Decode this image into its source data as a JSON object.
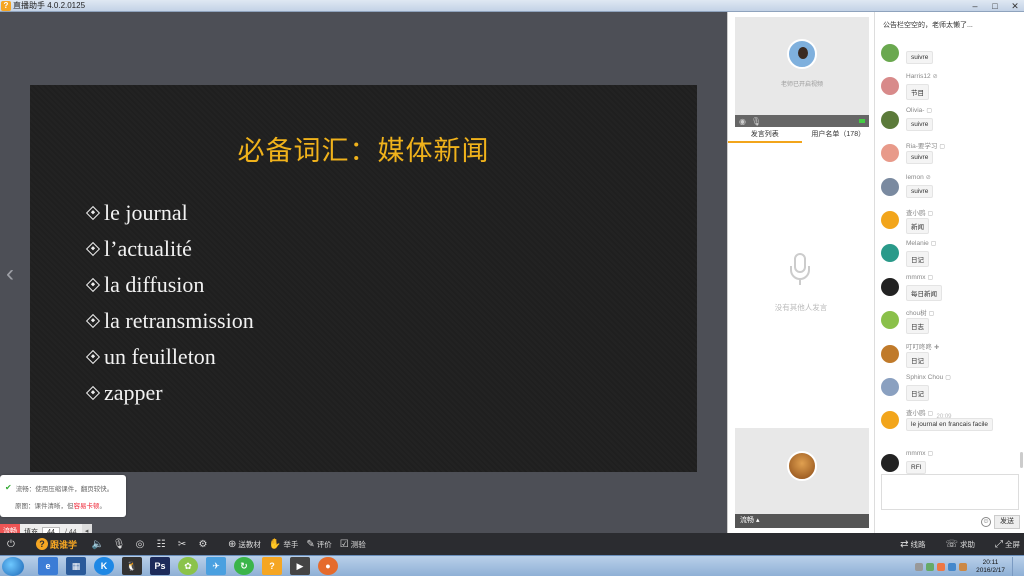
{
  "window": {
    "title": "直播助手 4.0.2.0125",
    "controls": [
      "–",
      "□",
      "✕"
    ]
  },
  "slide": {
    "title": "必备词汇：媒体新闻",
    "items": [
      "le journal",
      "l’actualité",
      "la diffusion",
      "la retransmission",
      "un feuilleton",
      "zapper"
    ]
  },
  "tip": {
    "line1": "流畅：使用压缩课件，翻页较快。",
    "line2_prefix": "原图：课件清晰，但",
    "line2_link": "容易卡顿",
    "line2_suffix": "。"
  },
  "pager": {
    "mode": "流畅",
    "fill_label": "填充",
    "current": "44",
    "total": "/ 44"
  },
  "teacher_video": {
    "caption": "老师已开启视频"
  },
  "tabs": [
    {
      "label": "发言列表"
    },
    {
      "label": "用户名单（178）"
    }
  ],
  "speak_empty": "没有其他人发言",
  "student_video": {
    "bar_label": "流畅 ▴"
  },
  "chat": {
    "notice": "公告栏空空的，老师太懒了...",
    "messages": [
      {
        "name": "",
        "badge": "",
        "text": "suivre",
        "color": "#6aa84f"
      },
      {
        "name": "Harris12",
        "badge": "⊘",
        "text": "节目",
        "color": "#d88a8a"
      },
      {
        "name": "Olivia-",
        "badge": "▢",
        "text": "suivre",
        "color": "#5b7a3a"
      },
      {
        "name": "Ria-要学习",
        "badge": "▢",
        "text": "suivre",
        "color": "#e89a8a"
      },
      {
        "name": "lemon",
        "badge": "⊘",
        "text": "suivre",
        "color": "#7a8aa0"
      },
      {
        "name": "查小鸥",
        "badge": "▢",
        "text": "新闻",
        "color": "#f2a51b"
      },
      {
        "name": "Melanie",
        "badge": "▢",
        "text": "日记",
        "color": "#2a9a8a"
      },
      {
        "name": "mmmx",
        "badge": "▢",
        "text": "每日新闻",
        "color": "#222222"
      },
      {
        "name": "chou树",
        "badge": "▢",
        "text": "日志",
        "color": "#8ac04a"
      },
      {
        "name": "叮叮咚咚",
        "badge": "✚",
        "text": "日记",
        "color": "#c07a2a"
      },
      {
        "name": "Sphinx Chou",
        "badge": "▢",
        "text": "日记",
        "color": "#8aa0c0"
      },
      {
        "name": "查小鸥",
        "badge": "▢",
        "text": "le journal en francais facile",
        "color": "#f2a51b"
      },
      {
        "name": "mmmx",
        "badge": "▢",
        "text": "RFI",
        "color": "#222222"
      }
    ],
    "time_divider": "20:09",
    "send_label": "发送",
    "emoji_icon": "☺"
  },
  "toolbar": {
    "logo_text": "跟谁学",
    "buttons": [
      {
        "label": "送教材",
        "icon": "⊕"
      },
      {
        "label": "举手",
        "icon": "✋"
      },
      {
        "label": "评价",
        "icon": "✎"
      },
      {
        "label": "测验",
        "icon": "☑"
      }
    ],
    "right": [
      {
        "label": "线路",
        "icon": "⇄"
      },
      {
        "label": "求助",
        "icon": "☏"
      },
      {
        "label": "全屏",
        "icon": "⤢"
      }
    ]
  },
  "taskbar": {
    "time": "20:11",
    "date": "2016/2/17"
  }
}
